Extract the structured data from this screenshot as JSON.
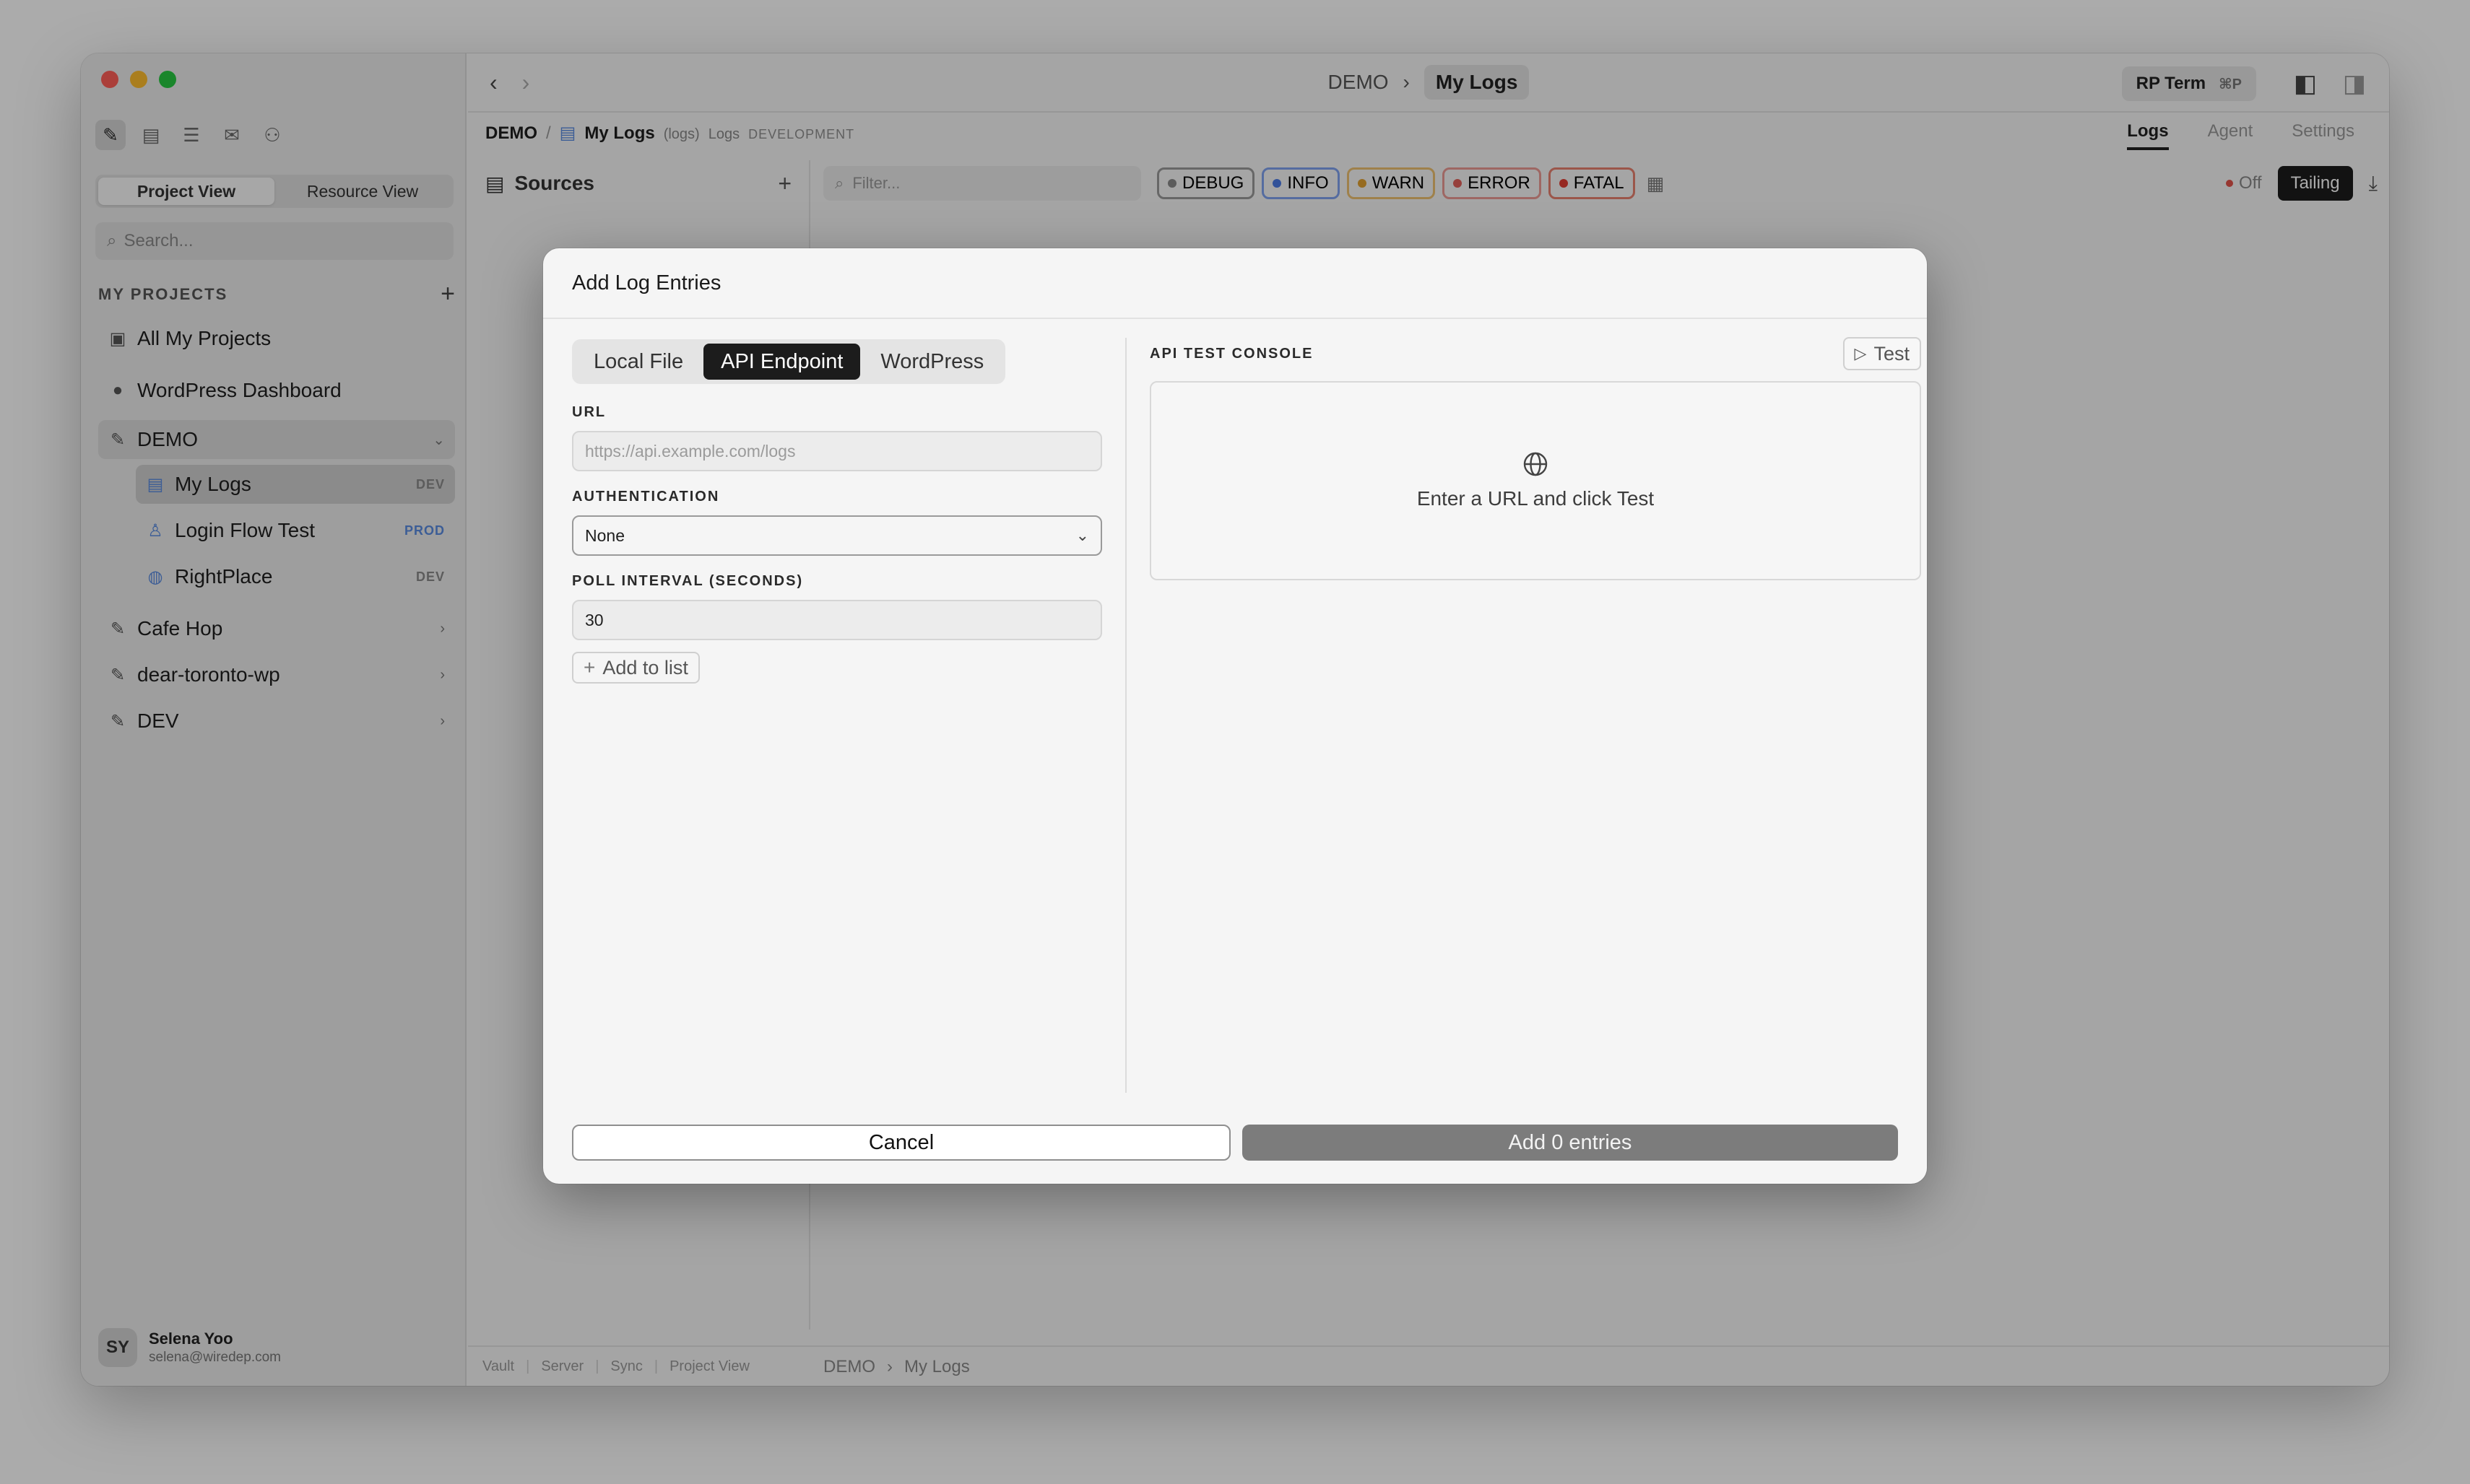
{
  "sidebar": {
    "segments": [
      "Project View",
      "Resource View"
    ],
    "search_placeholder": "Search...",
    "section_label": "MY PROJECTS",
    "items": [
      {
        "label": "All My Projects"
      },
      {
        "label": "WordPress Dashboard"
      },
      {
        "label": "DEMO"
      }
    ],
    "demo_children": [
      {
        "label": "My Logs",
        "badge": "DEV"
      },
      {
        "label": "Login Flow Test",
        "badge": "PROD"
      },
      {
        "label": "RightPlace",
        "badge": "DEV"
      }
    ],
    "projects": [
      {
        "label": "Cafe Hop"
      },
      {
        "label": "dear-toronto-wp"
      },
      {
        "label": "DEV"
      }
    ],
    "user": {
      "initials": "SY",
      "name": "Selena Yoo",
      "email": "selena@wiredep.com"
    }
  },
  "topbar": {
    "crumbs": [
      "DEMO",
      "My Logs"
    ],
    "rp_term": "RP Term",
    "rp_term_kbd": "⌘P"
  },
  "subbar": {
    "crumb_project": "DEMO",
    "crumb_page": "My Logs",
    "crumb_tag": "(logs)",
    "crumb_type": "Logs",
    "crumb_env": "DEVELOPMENT",
    "tabs": [
      "Logs",
      "Agent",
      "Settings"
    ]
  },
  "sources": {
    "title": "Sources"
  },
  "logbar": {
    "filter_placeholder": "Filter...",
    "levels": [
      {
        "label": "DEBUG",
        "color": "#8a8a8a"
      },
      {
        "label": "INFO",
        "color": "#4b7be5"
      },
      {
        "label": "WARN",
        "color": "#e0a030"
      },
      {
        "label": "ERROR",
        "color": "#e0605a"
      },
      {
        "label": "FATAL",
        "color": "#e03c32"
      }
    ],
    "off_label": "Off",
    "tailing_label": "Tailing"
  },
  "statusbar": {
    "items": [
      "Vault",
      "Server",
      "Sync",
      "Project View"
    ],
    "crumbs": [
      "DEMO",
      "My Logs"
    ]
  },
  "modal": {
    "title": "Add Log Entries",
    "tabs": [
      "Local File",
      "API Endpoint",
      "WordPress"
    ],
    "active_tab": "API Endpoint",
    "url_label": "URL",
    "url_placeholder": "https://api.example.com/logs",
    "auth_label": "AUTHENTICATION",
    "auth_value": "None",
    "poll_label": "POLL INTERVAL (SECONDS)",
    "poll_value": "30",
    "add_to_list": "Add to list",
    "console_label": "API TEST CONSOLE",
    "test_button": "Test",
    "console_hint": "Enter a URL and click Test",
    "cancel": "Cancel",
    "submit": "Add 0 entries"
  }
}
